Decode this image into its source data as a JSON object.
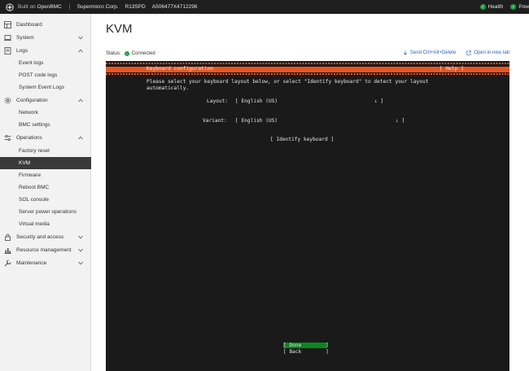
{
  "topbar": {
    "built_on": "Built on",
    "brand": "OpenBMC",
    "sep": "|",
    "vendor": "Supermicro Corp.",
    "model": "R13SPD",
    "serial": "A506477X4712296",
    "health": "Health",
    "power": "Pow"
  },
  "sidebar": {
    "items": [
      {
        "label": "Dashboard",
        "icon": "dashboard-icon"
      },
      {
        "label": "System",
        "icon": "system-icon"
      },
      {
        "label": "Logs",
        "icon": "logs-icon"
      },
      {
        "label": "Event logs"
      },
      {
        "label": "POST code logs"
      },
      {
        "label": "System Event Logs"
      },
      {
        "label": "Configuration",
        "icon": "settings-icon"
      },
      {
        "label": "Network"
      },
      {
        "label": "BMC settings"
      },
      {
        "label": "Operations",
        "icon": "sliders-icon"
      },
      {
        "label": "Factory reset"
      },
      {
        "label": "KVM"
      },
      {
        "label": "Firmware"
      },
      {
        "label": "Reboot BMC"
      },
      {
        "label": "SOL console"
      },
      {
        "label": "Server power operations"
      },
      {
        "label": "Virtual media"
      },
      {
        "label": "Security and access",
        "icon": "lock-icon"
      },
      {
        "label": "Resource management",
        "icon": "chart-icon"
      },
      {
        "label": "Maintenance",
        "icon": "wrench-icon"
      }
    ]
  },
  "main": {
    "title": "KVM",
    "status_label": "Status:",
    "status_value": "Connected",
    "send_cad": "Send Ctrl+Alt+Delete",
    "open_new_tab": "Open in new tab"
  },
  "terminal": {
    "header_title": "Keyboard configuration",
    "header_help": "[ Help ]",
    "intro_1": "Please select your keyboard layout below, or select \"Identify keyboard\" to detect your layout",
    "intro_2": "automatically.",
    "layout_label": "Layout:",
    "layout_value": "[ English (US)",
    "layout_arrow": "↓ ]",
    "variant_label": "Variant:",
    "variant_value": "[ English (US)",
    "variant_arrow": "↓ ]",
    "identify": "[ Identify keyboard ]",
    "done": "[ Done        ]",
    "back": "[ Back        ]"
  },
  "colors": {
    "accent_orange": "#e95420",
    "selected_green": "#0e8420",
    "status_green": "#1f9d3a",
    "link_blue": "#2a63b8"
  }
}
